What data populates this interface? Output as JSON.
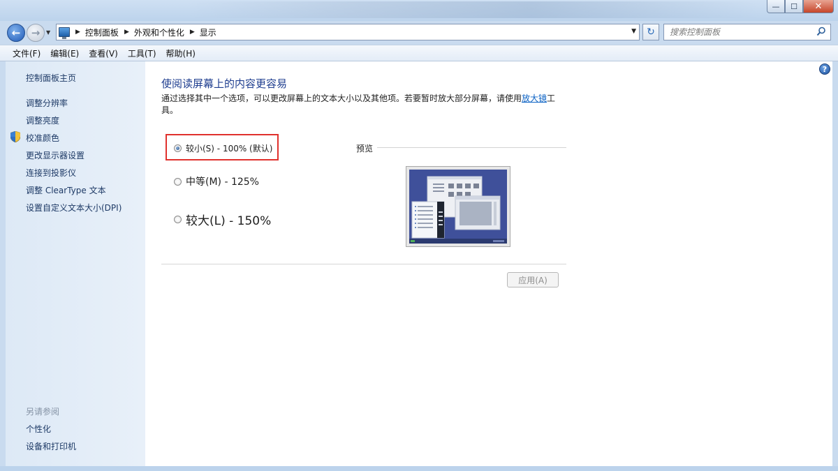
{
  "window": {
    "controls": {
      "minimize": "—",
      "maximize": "☐",
      "close": "✕"
    }
  },
  "nav": {
    "back_icon": "back-arrow-icon",
    "forward_icon": "forward-arrow-icon",
    "breadcrumb": [
      "控制面板",
      "外观和个性化",
      "显示"
    ],
    "search_placeholder": "搜索控制面板"
  },
  "menubar": {
    "items": [
      "文件(F)",
      "编辑(E)",
      "查看(V)",
      "工具(T)",
      "帮助(H)"
    ]
  },
  "sidebar": {
    "home": "控制面板主页",
    "links": [
      "调整分辨率",
      "调整亮度",
      "校准颜色",
      "更改显示器设置",
      "连接到投影仪",
      "调整 ClearType 文本",
      "设置自定义文本大小(DPI)"
    ],
    "see_also_title": "另请参阅",
    "see_also": [
      "个性化",
      "设备和打印机"
    ]
  },
  "main": {
    "title": "使阅读屏幕上的内容更容易",
    "desc_before": "通过选择其中一个选项，可以更改屏幕上的文本大小以及其他项。若要暂时放大部分屏幕，请使用",
    "desc_link": "放大镜",
    "desc_after": "工具。",
    "options": [
      {
        "label": "较小(S) - 100% (默认)",
        "checked": true
      },
      {
        "label": "中等(M) - 125%",
        "checked": false
      },
      {
        "label": "较大(L) - 150%",
        "checked": false
      }
    ],
    "preview_label": "预览",
    "apply_label": "应用(A)",
    "help": "?"
  },
  "colors": {
    "title_blue": "#1e3d8f",
    "link_blue": "#0b62c4",
    "highlight_red": "#e0312d",
    "sidebar_bg": "#e3edf8"
  }
}
